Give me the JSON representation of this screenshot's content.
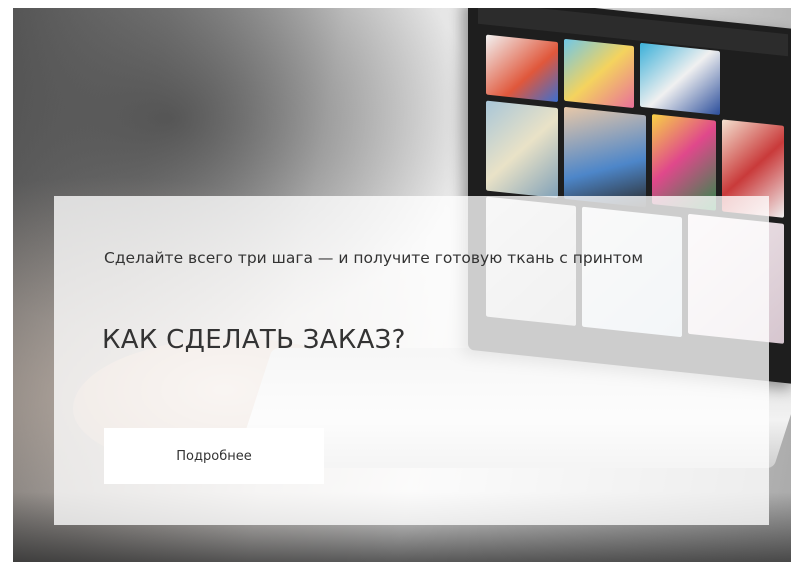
{
  "hero": {
    "subtitle": "Сделайте всего три шага — и получите готовую ткань с принтом",
    "title": "КАК СДЕЛАТЬ ЗАКАЗ?",
    "button_label": "Подробнее"
  },
  "colors": {
    "overlay": "rgba(255,255,255,0.78)",
    "text": "#333333",
    "button_bg": "#ffffff"
  }
}
